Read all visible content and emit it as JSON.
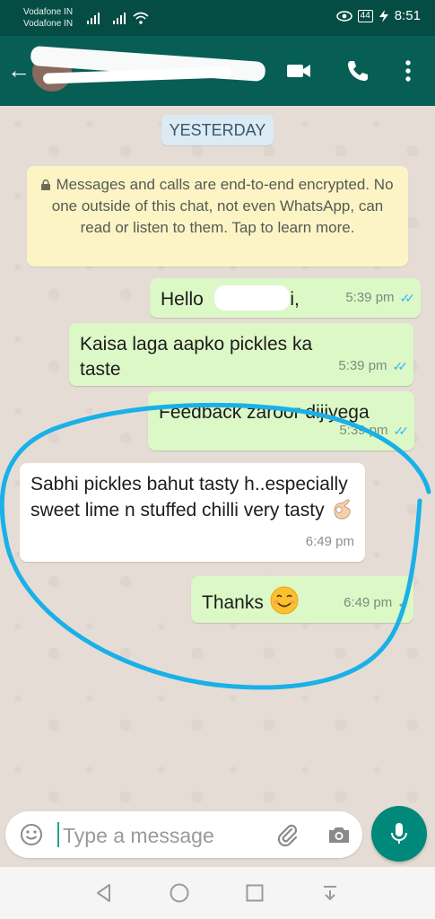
{
  "status_bar": {
    "carrier1": "Vodafone IN",
    "carrier2": "Vodafone IN",
    "battery": "44",
    "time": "8:51"
  },
  "app_bar": {
    "contact_name": "",
    "icons": [
      "back-arrow-icon",
      "video-call-icon",
      "voice-call-icon",
      "more-options-icon"
    ]
  },
  "chat": {
    "date_chip": "YESTERDAY",
    "encryption_notice": "Messages and calls are end-to-end encrypted. No one outside of this chat, not even WhatsApp, can read or listen to them. Tap to learn more.",
    "messages": [
      {
        "direction": "out",
        "text_before": "Hello",
        "text_after": "Ji,",
        "time": "5:39 pm",
        "status": "read"
      },
      {
        "direction": "out",
        "text": "Kaisa laga aapko pickles ka taste",
        "time": "5:39 pm",
        "status": "read"
      },
      {
        "direction": "out",
        "text": "Feedback zaroor dijiyega",
        "time": "5:39 pm",
        "status": "read"
      },
      {
        "direction": "in",
        "text": "Sabhi pickles bahut tasty h..especially sweet lime n stuffed chilli very tasty",
        "emoji": "ok-hand",
        "time": "6:49 pm"
      },
      {
        "direction": "out",
        "text": "Thanks",
        "emoji": "smiling-face",
        "time": "6:49 pm",
        "status": "sent"
      }
    ]
  },
  "annotation": {
    "color": "#1ab0e8",
    "shape": "freehand-ellipse"
  },
  "input_bar": {
    "placeholder": "Type a message"
  },
  "colors": {
    "header": "#075e54",
    "status_bar": "#054d44",
    "outgoing_bubble": "#dcf8c6",
    "incoming_bubble": "#ffffff",
    "mic_button": "#00897b",
    "read_ticks": "#34b7f1"
  },
  "nav_bar": {
    "icons": [
      "back-triangle-icon",
      "home-circle-icon",
      "recents-square-icon",
      "notification-pulldown-icon"
    ]
  }
}
